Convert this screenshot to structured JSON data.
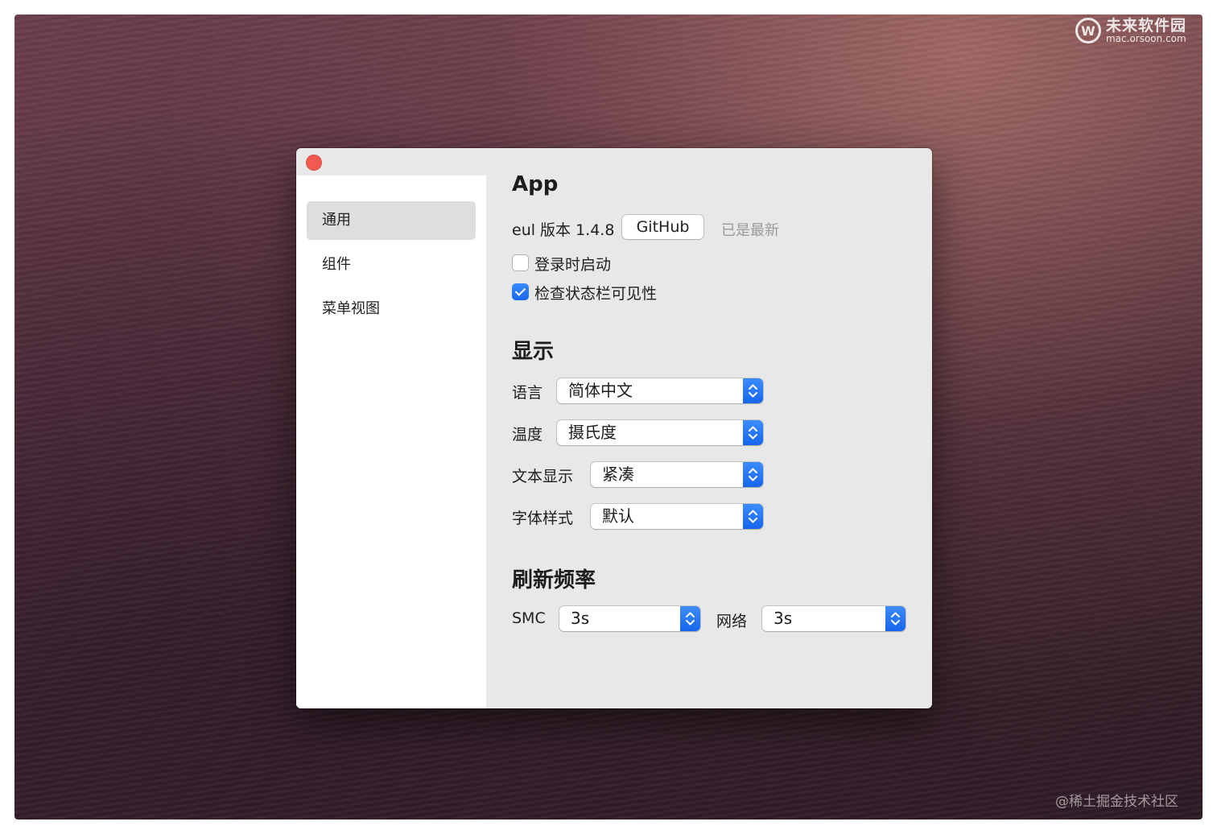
{
  "watermark": {
    "logo_mark": "W",
    "site_name": "未来软件园",
    "site_url": "mac.orsoon.com",
    "bottom_credit": "@稀土掘金技术社区"
  },
  "window": {
    "close_color": "#f25a50",
    "accent_color": "#1a6cf0",
    "sidebar": {
      "items": [
        {
          "label": "通用",
          "selected": true
        },
        {
          "label": "组件",
          "selected": false
        },
        {
          "label": "菜单视图",
          "selected": false
        }
      ]
    },
    "app_section": {
      "title": "App",
      "version_label": "eul 版本 1.4.8",
      "github_button": "GitHub",
      "update_status": "已是最新",
      "launch_at_login": {
        "label": "登录时启动",
        "checked": false
      },
      "check_statusbar": {
        "label": "检查状态栏可见性",
        "checked": true
      }
    },
    "display_section": {
      "title": "显示",
      "language": {
        "label": "语言",
        "value": "简体中文"
      },
      "temperature": {
        "label": "温度",
        "value": "摄氏度"
      },
      "text_display": {
        "label": "文本显示",
        "value": "紧凑"
      },
      "font_style": {
        "label": "字体样式",
        "value": "默认"
      }
    },
    "refresh_section": {
      "title": "刷新频率",
      "smc": {
        "label": "SMC",
        "value": "3s"
      },
      "network": {
        "label": "网络",
        "value": "3s"
      }
    }
  }
}
